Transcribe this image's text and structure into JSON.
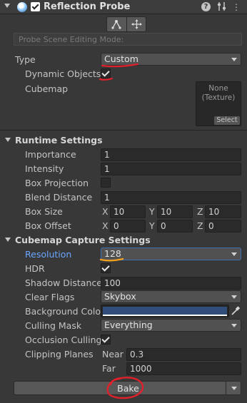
{
  "header": {
    "title": "Reflection Probe",
    "help_icon": "help-icon",
    "preset_icon": "preset-icon",
    "more_icon": "more-options-icon"
  },
  "toolbar": {
    "edit_bounds_icon": "edit-bounds-icon",
    "move_probe_icon": "move-probe-icon"
  },
  "probe_mode": {
    "text": "Probe Scene Editing Mode:"
  },
  "type": {
    "label": "Type",
    "value": "Custom"
  },
  "dynamic_objects": {
    "label": "Dynamic Objects",
    "checked": true
  },
  "cubemap": {
    "label": "Cubemap",
    "value": "None\n(Texture)",
    "select_label": "Select"
  },
  "runtime": {
    "title": "Runtime Settings",
    "importance": {
      "label": "Importance",
      "value": "1"
    },
    "intensity": {
      "label": "Intensity",
      "value": "1"
    },
    "box_projection": {
      "label": "Box Projection",
      "checked": false
    },
    "blend_distance": {
      "label": "Blend Distance",
      "value": "1"
    },
    "box_size": {
      "label": "Box Size",
      "x_label": "X",
      "x": "10",
      "y_label": "Y",
      "y": "10",
      "z_label": "Z",
      "z": "10"
    },
    "box_offset": {
      "label": "Box Offset",
      "x_label": "X",
      "x": "0",
      "y_label": "Y",
      "y": "0",
      "z_label": "Z",
      "z": "0"
    }
  },
  "capture": {
    "title": "Cubemap Capture Settings",
    "resolution": {
      "label": "Resolution",
      "value": "128"
    },
    "hdr": {
      "label": "HDR",
      "checked": true
    },
    "shadow_distance": {
      "label": "Shadow Distance",
      "value": "100"
    },
    "clear_flags": {
      "label": "Clear Flags",
      "value": "Skybox"
    },
    "background_color": {
      "label": "Background Color",
      "color": "#314d79"
    },
    "culling_mask": {
      "label": "Culling Mask",
      "value": "Everything"
    },
    "occlusion_culling": {
      "label": "Occlusion Culling",
      "checked": true
    },
    "clipping_planes": {
      "label": "Clipping Planes",
      "near_label": "Near",
      "near": "0.3",
      "far_label": "Far",
      "far": "1000"
    }
  },
  "bake": {
    "label": "Bake"
  },
  "colors": {
    "annotation_red": "#e0202a",
    "annotation_orange": "#f0a020",
    "highlight_blue": "#6aa6ff"
  }
}
